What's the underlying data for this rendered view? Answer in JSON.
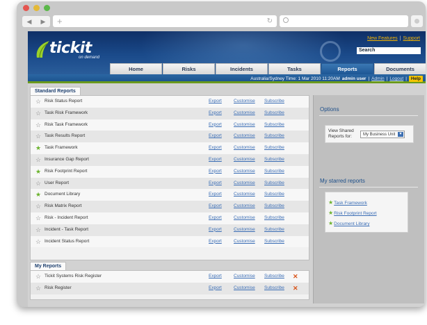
{
  "browser": {
    "back_label": "◀",
    "forward_label": "▶",
    "new_tab_label": "+",
    "reload_label": "↻"
  },
  "header": {
    "logo": "tickit",
    "logo_sub": "on demand",
    "links": [
      "New Features",
      "Support"
    ],
    "search_label": "Search"
  },
  "tabs": [
    {
      "label": "Home"
    },
    {
      "label": "Risks"
    },
    {
      "label": "Incidents"
    },
    {
      "label": "Tasks"
    },
    {
      "label": "Reports",
      "active": true
    },
    {
      "label": "Documents"
    }
  ],
  "status": {
    "location_time": "Australia/Sydney Time: 1 Mar 2010 11:20AM",
    "user": "admin user",
    "admin": "Admin",
    "logout": "Logout",
    "help": "Help"
  },
  "standard_reports": {
    "title": "Standard Reports",
    "rows": [
      {
        "name": "Risk Status Report",
        "starred": false
      },
      {
        "name": "Task Risk Framework",
        "starred": false
      },
      {
        "name": "Risk Task Framework",
        "starred": false
      },
      {
        "name": "Task Results Report",
        "starred": false
      },
      {
        "name": "Task Framework",
        "starred": true
      },
      {
        "name": "Insurance Gap Report",
        "starred": false
      },
      {
        "name": "Risk Footprint Report",
        "starred": true
      },
      {
        "name": "User Report",
        "starred": false
      },
      {
        "name": "Document Library",
        "starred": true
      },
      {
        "name": "Risk Matrix Report",
        "starred": false
      },
      {
        "name": "Risk - Incident Report",
        "starred": false
      },
      {
        "name": "Incident - Task Report",
        "starred": false
      },
      {
        "name": "Incident Status Report",
        "starred": false
      }
    ]
  },
  "actions": {
    "export": "Export",
    "customise": "Customise",
    "subscribe": "Subscribe"
  },
  "my_reports": {
    "title": "My Reports",
    "rows": [
      {
        "name": "Tickit Systems Risk Register"
      },
      {
        "name": "Risk Register"
      }
    ]
  },
  "options": {
    "title": "Options",
    "label": "View Shared Reports for:",
    "select_value": "My Business Unit"
  },
  "starred": {
    "title": "My starred reports",
    "items": [
      "Task Framework",
      "Risk Footprint Report",
      "Document Library"
    ]
  },
  "colors": {
    "header_blue": "#1a4a8a",
    "link": "#3a6db5",
    "accent_yellow": "#f4c400",
    "star_green": "#6ab22b",
    "delete_orange": "#d9541a"
  }
}
